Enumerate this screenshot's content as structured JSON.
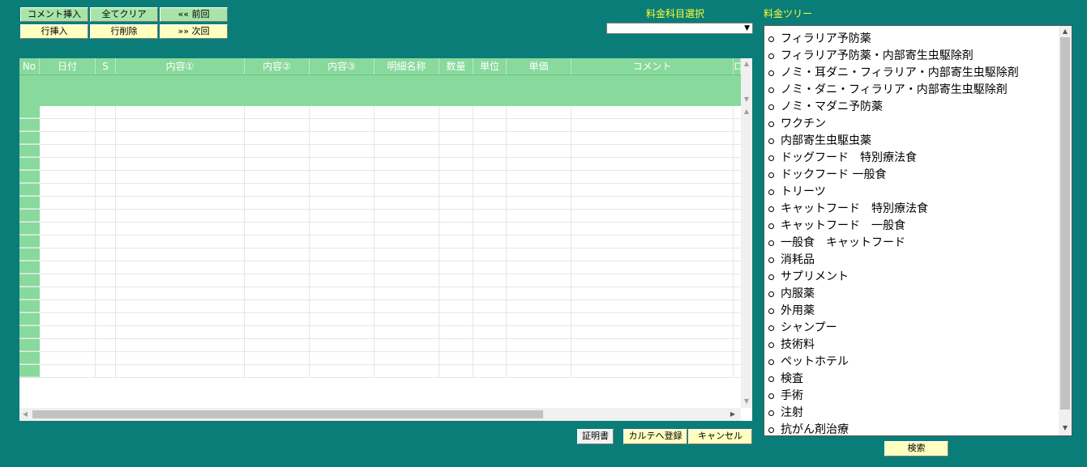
{
  "toolbar": {
    "comment_insert": "コメント挿入",
    "clear_all": "全てクリア",
    "prev": "«« 前回",
    "row_insert": "行挿入",
    "row_delete": "行削除",
    "next": "»» 次回"
  },
  "fee_select": {
    "label": "料金科目選択",
    "value": ""
  },
  "tree": {
    "label": "料金ツリー",
    "items": [
      "フィラリア予防薬",
      "フィラリア予防薬・内部寄生虫駆除剤",
      "ノミ・耳ダニ・フィラリア・内部寄生虫駆除剤",
      "ノミ・ダニ・フィラリア・内部寄生虫駆除剤",
      "ノミ・マダニ予防薬",
      "ワクチン",
      "内部寄生虫駆虫薬",
      "ドッグフード　特別療法食",
      "ドックフード 一般食",
      "トリーツ",
      "キャットフード　特別療法食",
      "キャットフード　一般食",
      "一般食　キャットフード",
      "消耗品",
      "サプリメント",
      "内服薬",
      "外用薬",
      "シャンプー",
      "技術料",
      "ペットホテル",
      "検査",
      "手術",
      "注射",
      "抗がん剤治療"
    ],
    "search_button": "検索"
  },
  "grid": {
    "columns": [
      "No",
      "日付",
      "S",
      "内容①",
      "内容②",
      "内容③",
      "明細名称",
      "数量",
      "単位",
      "単価",
      "コメント",
      "ロ"
    ]
  },
  "footer": {
    "certificate": "証明書",
    "register_karte": "カルテへ登録",
    "cancel": "キャンセル"
  },
  "colors": {
    "background": "#0b7d78",
    "grid_header": "#88d99c",
    "label_yellow": "#ffff33",
    "button_green": "#a8e4a8",
    "button_yellow": "#ffffc0"
  }
}
